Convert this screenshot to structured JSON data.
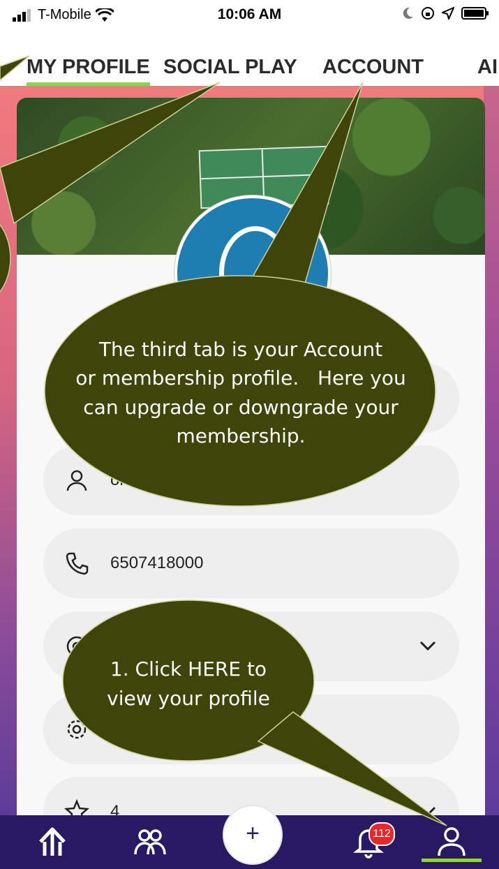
{
  "status_bar": {
    "carrier": "T-Mobile",
    "time": "10:06 AM"
  },
  "tabs": [
    {
      "label": "MY PROFILE",
      "active": true
    },
    {
      "label": "SOCIAL PLAY",
      "active": false
    },
    {
      "label": "ACCOUNT",
      "active": false
    },
    {
      "label": "AI",
      "active": false
    }
  ],
  "profile": {
    "fields": [
      {
        "text": "",
        "icon": "email-icon"
      },
      {
        "text": "on",
        "icon": "person-icon"
      },
      {
        "text": "6507418000",
        "icon": "phone-icon"
      },
      {
        "text": "",
        "icon": "location-icon",
        "dropdown": true
      },
      {
        "text": "",
        "icon": "gear-icon"
      },
      {
        "text": "4",
        "icon": "star-icon",
        "dropdown": true
      }
    ]
  },
  "bottom_nav": {
    "notifications_badge": "112",
    "plus_label": "+"
  },
  "callouts": {
    "account": "The third tab is your Account or membership profile.   Here you can upgrade or downgrade your membership.",
    "account_lines": [
      "The third tab is your Account",
      "or membership profile.   Here you",
      "can upgrade or downgrade your",
      "membership."
    ],
    "profile_lines": [
      "1. Click HERE to",
      "view your profile"
    ]
  },
  "colors": {
    "accent_green": "#8ed14a",
    "nav_bg": "#271a63",
    "callout_fill": "#3d4508",
    "badge_red": "#e8262b"
  }
}
